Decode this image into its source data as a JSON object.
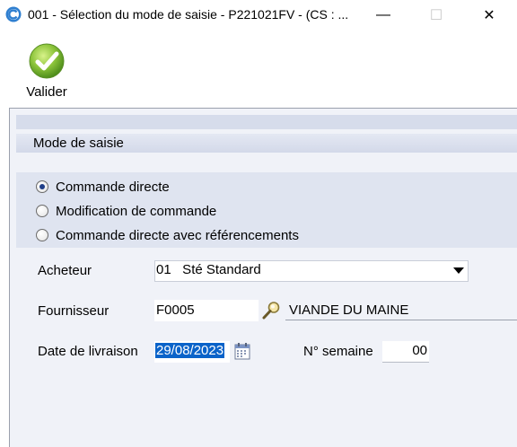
{
  "window": {
    "title": "001 - Sélection du mode de saisie - P221021FV - (CS : ...",
    "minimize": "—",
    "maximize": "☐",
    "close": "✕",
    "icon": "app-logo-icon"
  },
  "toolbar": {
    "validate_label": "Valider",
    "validate_icon": "green-checkmark-icon"
  },
  "section": {
    "title": "Mode de saisie"
  },
  "modes": [
    {
      "label": "Commande directe",
      "selected": true
    },
    {
      "label": "Modification de commande",
      "selected": false
    },
    {
      "label": "Commande directe avec référencements",
      "selected": false
    }
  ],
  "form": {
    "buyer_label": "Acheteur",
    "buyer_value": "01   Sté Standard",
    "supplier_label": "Fournisseur",
    "supplier_code": "F0005",
    "supplier_name": "VIANDE DU MAINE",
    "date_label": "Date de livraison",
    "date_value": "29/08/2023",
    "week_label": "N° semaine",
    "week_value": "00"
  },
  "colors": {
    "accent": "#0a63c9",
    "panel": "#f0f2f8",
    "section_band": "#dfe4f0"
  }
}
